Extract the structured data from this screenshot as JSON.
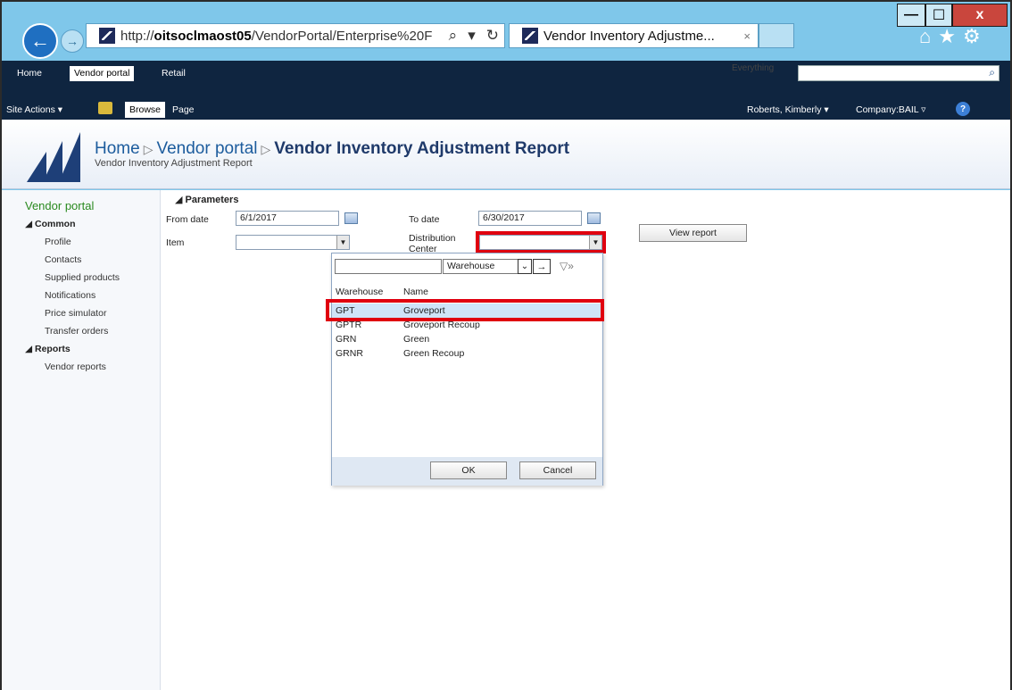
{
  "browser": {
    "url_prefix": "http://",
    "url_host": "oitsoclmaost05",
    "url_path": "/VendorPortal/Enterprise%20F",
    "tab_title": "Vendor Inventory Adjustme...",
    "tab_close": "×"
  },
  "window_controls": {
    "minimize": "—",
    "maximize": "☐",
    "close": "x"
  },
  "top_nav": {
    "links": [
      "Home",
      "Vendor portal",
      "Retail"
    ],
    "search_scope": "Everything"
  },
  "ribbon": {
    "site_actions": "Site Actions ▾",
    "tabs": [
      "Browse",
      "Page"
    ],
    "user": "Roberts, Kimberly ▾",
    "company": "Company:BAIL ▿",
    "help": "?"
  },
  "title_area": {
    "bc_home": "Home",
    "bc_portal": "Vendor portal",
    "bc_page": "Vendor Inventory Adjustment Report",
    "subtitle": "Vendor Inventory Adjustment Report"
  },
  "left_nav": {
    "title": "Vendor portal",
    "common": "◢ Common",
    "common_items": [
      "Profile",
      "Contacts",
      "Supplied products",
      "Notifications",
      "Price simulator",
      "Transfer orders"
    ],
    "reports": "◢ Reports",
    "report_items": [
      "Vendor reports"
    ]
  },
  "parameters": {
    "heading": "◢ Parameters",
    "from_date_label": "From date",
    "from_date": "6/1/2017",
    "to_date_label": "To date",
    "to_date": "6/30/2017",
    "item_label": "Item",
    "dc_label_1": "Distribution",
    "dc_label_2": "Center",
    "view_report": "View report"
  },
  "lookup": {
    "filter_field": "Warehouse",
    "col_warehouse": "Warehouse",
    "col_name": "Name",
    "rows": [
      {
        "code": "GPT",
        "name": "Groveport"
      },
      {
        "code": "GPTR",
        "name": "Groveport Recoup"
      },
      {
        "code": "GRN",
        "name": "Green"
      },
      {
        "code": "GRNR",
        "name": "Green Recoup"
      }
    ],
    "ok": "OK",
    "cancel": "Cancel"
  }
}
